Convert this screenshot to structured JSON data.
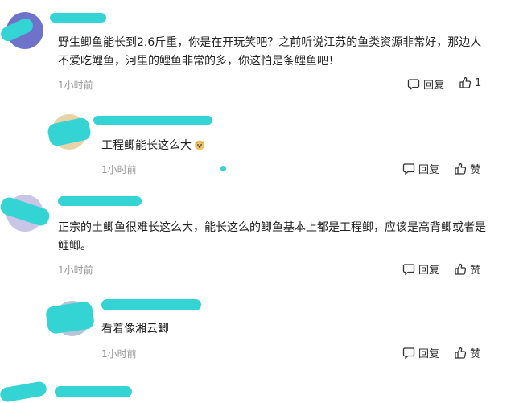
{
  "comments": [
    {
      "text_line1": "野生鲫鱼能长到2.6斤重，你是在开玩笑吧？之前听说江苏的鱼类资源非常好，那边人",
      "text_line2": "不爱吃鲤鱼，河里的鲤鱼非常的多，你这怕是条鲤鱼吧！",
      "time": "1小时前",
      "reply_label": "回复",
      "like_count": "1"
    },
    {
      "text": "工程鲫能长这么大",
      "time": "1小时前",
      "reply_label": "回复",
      "like_label": "赞"
    },
    {
      "text_line1": "正宗的土鲫鱼很难长这么大，能长这么的鲫鱼基本上都是工程鲫，应该是高背鲫或者是",
      "text_line2": "鲤鲫。",
      "time": "1小时前",
      "reply_label": "回复",
      "like_label": "赞"
    },
    {
      "text": "看着像湘云鲫",
      "time": "1小时前",
      "reply_label": "回复",
      "like_label": "赞"
    }
  ],
  "colors": {
    "redaction": "#35d4d4",
    "muted": "#999999"
  }
}
